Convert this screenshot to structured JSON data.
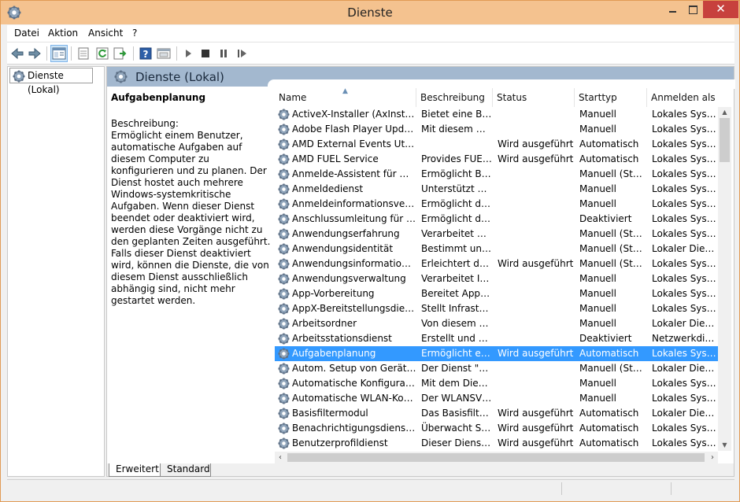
{
  "window": {
    "title": "Dienste"
  },
  "menu": [
    "Datei",
    "Aktion",
    "Ansicht",
    "?"
  ],
  "toolbar_icons": [
    "back-arrow-icon",
    "forward-arrow-icon",
    "console-tree-icon",
    "properties-icon",
    "refresh-icon",
    "export-icon",
    "help-icon",
    "mmc-icon",
    "play-icon",
    "stop-icon",
    "pause-icon",
    "restart-icon"
  ],
  "tree": {
    "node": "Dienste (Lokal)"
  },
  "main": {
    "header": "Dienste (Lokal)",
    "selected_name": "Aufgabenplanung",
    "desc_label": "Beschreibung:",
    "desc_text": "Ermöglicht einem Benutzer, automatische Aufgaben auf diesem Computer zu konfigurieren und zu planen. Der Dienst hostet auch mehrere Windows-systemkritische Aufgaben. Wenn dieser Dienst beendet oder deaktiviert wird, werden diese Vorgänge nicht zu den geplanten Zeiten ausgeführt. Falls dieser Dienst deaktiviert wird, können die Dienste, die von diesem Dienst ausschließlich abhängig sind, nicht mehr gestartet werden."
  },
  "columns": [
    "Name",
    "Beschreibung",
    "Status",
    "Starttyp",
    "Anmelden als"
  ],
  "rows": [
    {
      "name": "ActiveX-Installer (AxInstSV)",
      "desc": "Bietet eine Be...",
      "status": "",
      "start": "Manuell",
      "logon": "Lokales System"
    },
    {
      "name": "Adobe Flash Player Update ...",
      "desc": "Mit diesem Di...",
      "status": "",
      "start": "Manuell",
      "logon": "Lokales System"
    },
    {
      "name": "AMD External Events Utility",
      "desc": "",
      "status": "Wird ausgeführt",
      "start": "Automatisch",
      "logon": "Lokales System"
    },
    {
      "name": "AMD FUEL Service",
      "desc": "Provides FUEL...",
      "status": "Wird ausgeführt",
      "start": "Automatisch",
      "logon": "Lokales System"
    },
    {
      "name": "Anmelde-Assistent für Micr...",
      "desc": "Ermöglicht Be...",
      "status": "",
      "start": "Manuell (Star...",
      "logon": "Lokales System"
    },
    {
      "name": "Anmeldedienst",
      "desc": "Unterstützt ei...",
      "status": "",
      "start": "Manuell",
      "logon": "Lokales System"
    },
    {
      "name": "Anmeldeinformationsverwa...",
      "desc": "Ermöglicht da...",
      "status": "",
      "start": "Manuell",
      "logon": "Lokales System"
    },
    {
      "name": "Anschlussumleitung für Re...",
      "desc": "Ermöglicht di...",
      "status": "",
      "start": "Deaktiviert",
      "logon": "Lokales System"
    },
    {
      "name": "Anwendungserfahrung",
      "desc": "Verarbeitet An...",
      "status": "",
      "start": "Manuell (Star...",
      "logon": "Lokales System"
    },
    {
      "name": "Anwendungsidentität",
      "desc": "Bestimmt und...",
      "status": "",
      "start": "Manuell (Star...",
      "logon": "Lokaler Dienst"
    },
    {
      "name": "Anwendungsinformationen",
      "desc": "Erleichtert das...",
      "status": "Wird ausgeführt",
      "start": "Manuell (Star...",
      "logon": "Lokales System"
    },
    {
      "name": "Anwendungsverwaltung",
      "desc": "Verarbeitet Ins...",
      "status": "",
      "start": "Manuell",
      "logon": "Lokales System"
    },
    {
      "name": "App-Vorbereitung",
      "desc": "Bereitet Apps ...",
      "status": "",
      "start": "Manuell",
      "logon": "Lokales System"
    },
    {
      "name": "AppX-Bereitstellungsdienst ...",
      "desc": "Stellt Infrastru...",
      "status": "",
      "start": "Manuell",
      "logon": "Lokales System"
    },
    {
      "name": "Arbeitsordner",
      "desc": "Von diesem Di...",
      "status": "",
      "start": "Manuell",
      "logon": "Lokaler Dienst"
    },
    {
      "name": "Arbeitsstationsdienst",
      "desc": "Erstellt und w...",
      "status": "",
      "start": "Deaktiviert",
      "logon": "Netzwerkdienst"
    },
    {
      "name": "Aufgabenplanung",
      "desc": "Ermöglicht ei...",
      "status": "Wird ausgeführt",
      "start": "Automatisch",
      "logon": "Lokales System",
      "selected": true
    },
    {
      "name": "Autom. Setup von Geräten, ...",
      "desc": "Der Dienst \"A...",
      "status": "",
      "start": "Manuell (Star...",
      "logon": "Lokaler Dienst"
    },
    {
      "name": "Automatische Konfiguratio...",
      "desc": "Mit dem Dien...",
      "status": "",
      "start": "Manuell",
      "logon": "Lokales System"
    },
    {
      "name": "Automatische WLAN-Konfi...",
      "desc": "Der WLANSVC...",
      "status": "",
      "start": "Manuell",
      "logon": "Lokales System"
    },
    {
      "name": "Basisfiltermodul",
      "desc": "Das Basisfilter...",
      "status": "Wird ausgeführt",
      "start": "Automatisch",
      "logon": "Lokaler Dienst"
    },
    {
      "name": "Benachrichtigungsdienst fü...",
      "desc": "Überwacht Sy...",
      "status": "Wird ausgeführt",
      "start": "Automatisch",
      "logon": "Lokales System"
    },
    {
      "name": "Benutzerprofildienst",
      "desc": "Dieser Dienst i...",
      "status": "Wird ausgeführt",
      "start": "Automatisch",
      "logon": "Lokales System"
    }
  ],
  "tabs": [
    "Erweitert",
    "Standard"
  ],
  "colors": {
    "titlebar": "#f4c28f",
    "header": "#a3b8cf",
    "selection": "#3399ff",
    "close": "#c7413d"
  }
}
